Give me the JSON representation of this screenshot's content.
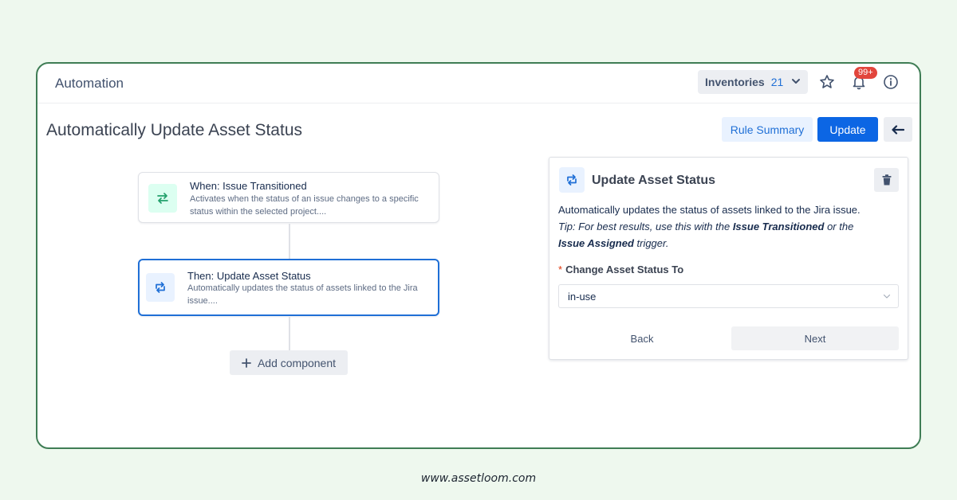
{
  "app": {
    "title": "Automation"
  },
  "header": {
    "inventory_label": "Inventories",
    "inventory_count": "21",
    "notification_badge": "99+"
  },
  "page": {
    "title": "Automatically Update Asset Status",
    "rule_summary_label": "Rule Summary",
    "update_label": "Update"
  },
  "flow": {
    "when": {
      "title": "When: Issue Transitioned",
      "description": "Activates when the status of an issue changes to a specific status within the selected project...."
    },
    "then": {
      "title": "Then: Update Asset Status",
      "description": "Automatically updates the status of assets linked to the Jira issue...."
    },
    "add_component_label": "Add component"
  },
  "panel": {
    "title": "Update Asset Status",
    "description": "Automatically updates the status of assets linked to the Jira issue.",
    "tip_prefix": "Tip: For best results, use this with the ",
    "tip_trigger_1": "Issue Transitioned",
    "tip_middle": " or the ",
    "tip_trigger_2": "Issue Assigned",
    "tip_suffix": " trigger.",
    "field_required_mark": "*",
    "field_label": "Change Asset Status To",
    "field_value": "in-use",
    "back_label": "Back",
    "next_label": "Next"
  },
  "footer": {
    "url": "www.assetloom.com"
  },
  "colors": {
    "background": "#eef8ee",
    "frame_border": "#3f7d55",
    "primary": "#0c66e4",
    "badge": "#e2453c"
  }
}
